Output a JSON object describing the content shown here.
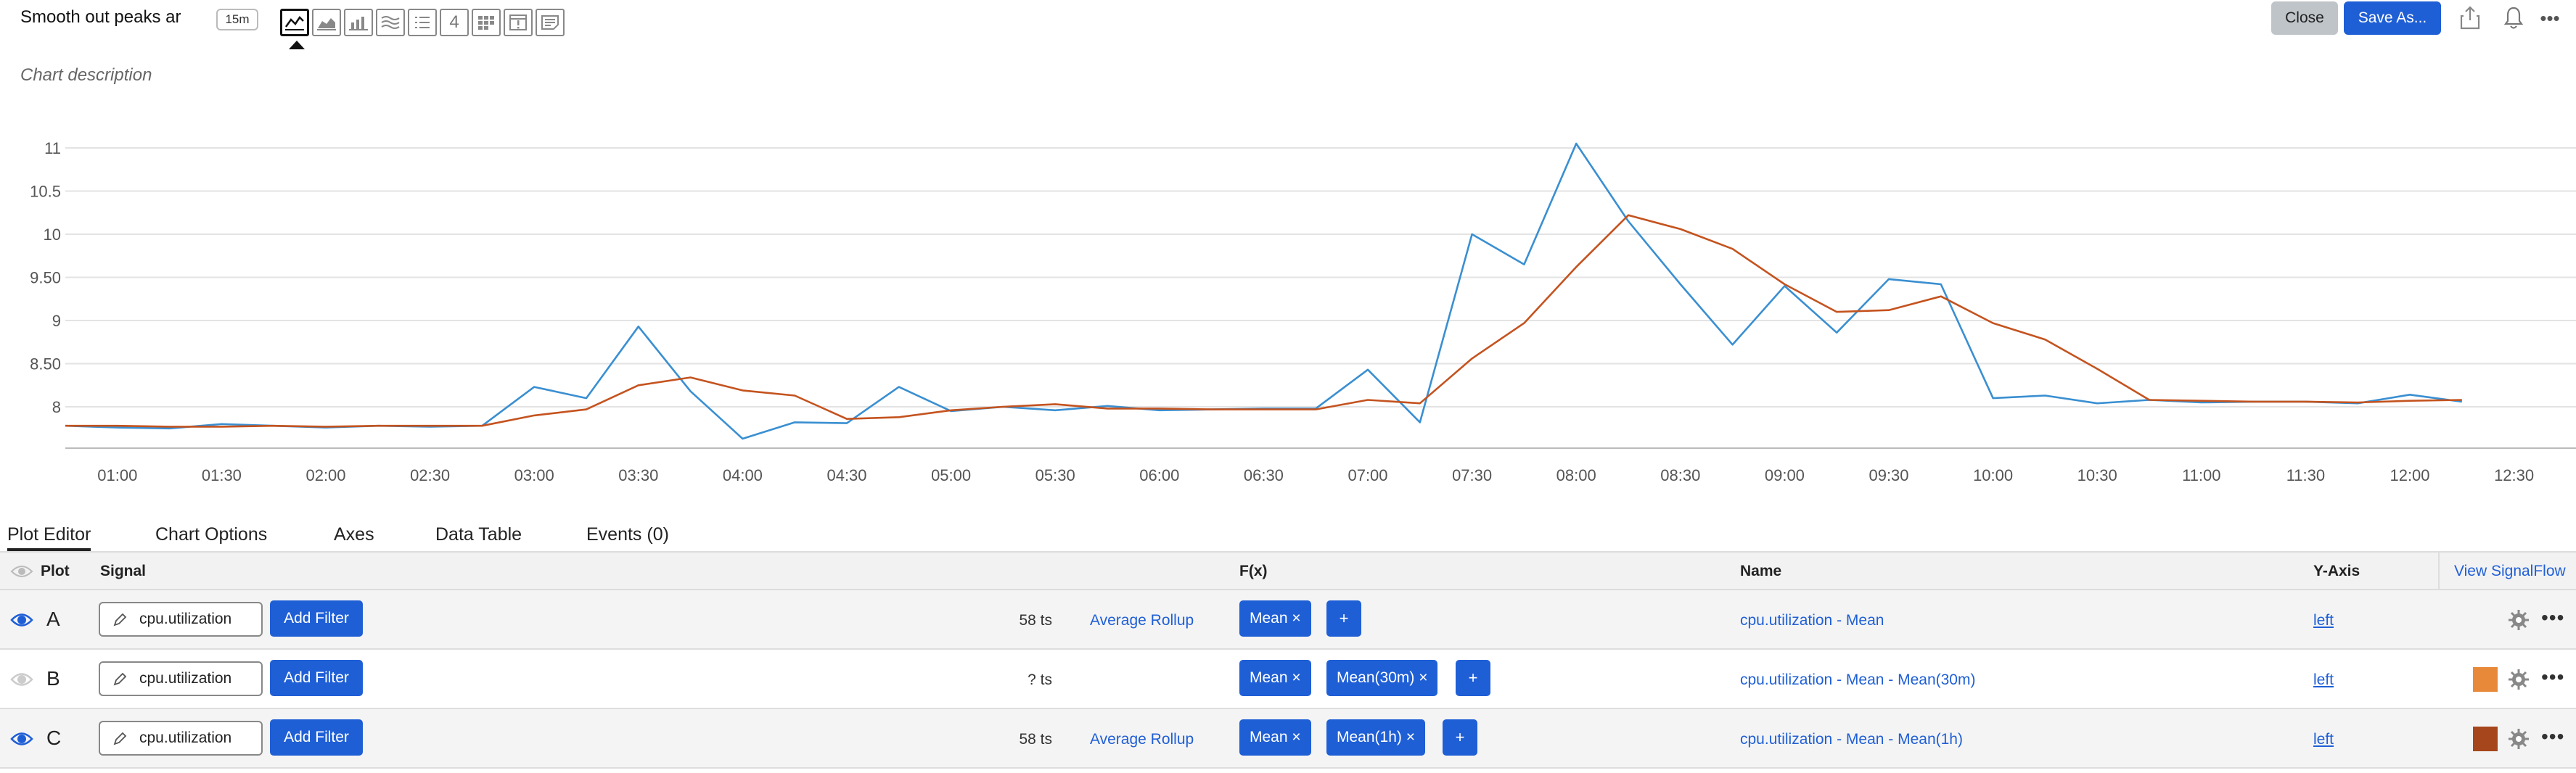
{
  "header": {
    "title": "Smooth out peaks ar",
    "time_range": "15m",
    "chart_type_icons": [
      "line-chart-icon",
      "area-chart-icon",
      "column-chart-icon",
      "histogram-icon",
      "list-icon",
      "single-value-icon",
      "heatmap-icon",
      "event-feed-icon",
      "text-note-icon"
    ],
    "single_value_glyph": "4",
    "close_label": "Close",
    "save_label": "Save As...",
    "toolbar_icons": [
      "share-icon",
      "bell-icon",
      "more-icon"
    ]
  },
  "description_placeholder": "Chart description",
  "chart_data": {
    "type": "line",
    "x": [
      "00:45",
      "01:00",
      "01:15",
      "01:30",
      "01:45",
      "02:00",
      "02:15",
      "02:30",
      "02:45",
      "03:00",
      "03:15",
      "03:30",
      "03:45",
      "04:00",
      "04:15",
      "04:30",
      "04:45",
      "05:00",
      "05:15",
      "05:30",
      "05:45",
      "06:00",
      "06:15",
      "06:30",
      "06:45",
      "07:00",
      "07:15",
      "07:30",
      "07:45",
      "08:00",
      "08:15",
      "08:30",
      "08:45",
      "09:00",
      "09:15",
      "09:30",
      "09:45",
      "10:00",
      "10:15",
      "10:30",
      "10:45",
      "11:00",
      "11:15",
      "11:30",
      "11:45",
      "12:00",
      "12:15"
    ],
    "xticks": [
      "01:00",
      "01:30",
      "02:00",
      "02:30",
      "03:00",
      "03:30",
      "04:00",
      "04:30",
      "05:00",
      "05:30",
      "06:00",
      "06:30",
      "07:00",
      "07:30",
      "08:00",
      "08:30",
      "09:00",
      "09:30",
      "10:00",
      "10:30",
      "11:00",
      "11:30",
      "12:00",
      "12:30"
    ],
    "yticks": [
      "8",
      "8.50",
      "9",
      "9.50",
      "10",
      "10.5",
      "11"
    ],
    "ylim": [
      7.55,
      11.3
    ],
    "series": [
      {
        "color": "#3a8fd1",
        "values": [
          7.78,
          7.76,
          7.75,
          7.8,
          7.78,
          7.76,
          7.78,
          7.77,
          7.78,
          8.23,
          8.1,
          8.93,
          8.18,
          7.63,
          7.82,
          7.81,
          8.23,
          7.95,
          8.0,
          7.96,
          8.01,
          7.96,
          7.97,
          7.98,
          7.98,
          8.43,
          7.82,
          10.0,
          9.65,
          11.05,
          10.15,
          9.42,
          8.72,
          9.4,
          8.86,
          9.48,
          9.42,
          8.1,
          8.13,
          8.04,
          8.08,
          8.05,
          8.06,
          8.06,
          8.04,
          8.14,
          8.06
        ]
      },
      {
        "color": "#c4531f",
        "values": [
          7.78,
          7.78,
          7.77,
          7.77,
          7.78,
          7.77,
          7.78,
          7.78,
          7.78,
          7.9,
          7.97,
          8.25,
          8.34,
          8.19,
          8.13,
          7.86,
          7.88,
          7.96,
          8.0,
          8.03,
          7.98,
          7.98,
          7.97,
          7.97,
          7.97,
          8.08,
          8.04,
          8.56,
          8.97,
          9.62,
          10.22,
          10.06,
          9.83,
          9.42,
          9.1,
          9.12,
          9.28,
          8.97,
          8.78,
          8.44,
          8.08,
          8.07,
          8.06,
          8.06,
          8.05,
          8.07,
          8.08
        ]
      }
    ]
  },
  "tabs": [
    "Plot Editor",
    "Chart Options",
    "Axes",
    "Data Table",
    "Events (0)"
  ],
  "grid": {
    "headers": {
      "plot": "Plot",
      "signal": "Signal",
      "fx": "F(x)",
      "name": "Name",
      "yaxis": "Y-Axis",
      "view_signalflow": "View SignalFlow"
    },
    "rows": [
      {
        "letter": "A",
        "visible": true,
        "signal": "cpu.utilization",
        "add_filter": "Add Filter",
        "ts": "58 ts",
        "rollup": "Average Rollup",
        "fx": [
          "Mean ×"
        ],
        "fx_add": "+",
        "name": "cpu.utilization - Mean",
        "yaxis": "left",
        "swatch": "",
        "more": "•••"
      },
      {
        "letter": "B",
        "visible": false,
        "signal": "cpu.utilization",
        "add_filter": "Add Filter",
        "ts": "? ts",
        "rollup": "",
        "fx": [
          "Mean ×",
          "Mean(30m) ×"
        ],
        "fx_add": "+",
        "name": "cpu.utilization - Mean - Mean(30m)",
        "yaxis": "left",
        "swatch": "#e8893a",
        "more": "•••"
      },
      {
        "letter": "C",
        "visible": true,
        "signal": "cpu.utilization",
        "add_filter": "Add Filter",
        "ts": "58 ts",
        "rollup": "Average Rollup",
        "fx": [
          "Mean ×",
          "Mean(1h) ×"
        ],
        "fx_add": "+",
        "name": "cpu.utilization - Mean - Mean(1h)",
        "yaxis": "left",
        "swatch": "#a6461c",
        "more": "•••"
      }
    ]
  }
}
